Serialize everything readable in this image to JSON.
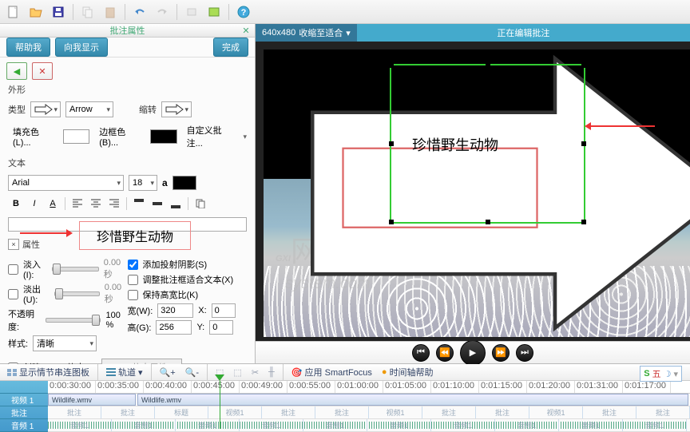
{
  "toolbar": {
    "new": "新建",
    "open": "打开",
    "save": "保存"
  },
  "panel": {
    "title": "批注属性",
    "help_me": "帮助我",
    "show_me": "向我显示",
    "finish": "完成"
  },
  "shape": {
    "section": "外形",
    "type_label": "类型",
    "type_value": "Arrow",
    "rotate_label": "缩转",
    "fill_label": "填充色(L)...",
    "border_label": "边框色(B)...",
    "custom_label": "自定义批注..."
  },
  "text": {
    "section": "文本",
    "font": "Arial",
    "size": "18",
    "content": "珍惜野生动物"
  },
  "props": {
    "section": "属性",
    "fadein_label": "淡入(I):",
    "fadein_value": "0.00 秒",
    "fadeout_label": "淡出(U):",
    "fadeout_value": "0.00 秒",
    "opacity_label": "不透明度:",
    "opacity_value": "100 %",
    "style_label": "样式:",
    "style_value": "清晰",
    "shadow_label": "添加投射阴影(S)",
    "fit_text_label": "调整批注框适合文本(X)",
    "keep_ratio_label": "保持高宽比(K)",
    "width_label": "宽(W):",
    "width_value": "320",
    "width_unit": "X:",
    "width_x": "0",
    "height_label": "高(G):",
    "height_value": "256",
    "height_unit": "Y:",
    "height_y": "0",
    "hotspot_label": "创建 Flash 热点(P)",
    "hotspot_btn": "Flash 热点属性..."
  },
  "preview": {
    "dims": "640x480",
    "zoom": "收缩至适合",
    "editing": "正在编辑批注",
    "callout_text": "珍惜野生动物",
    "wm_big": "GXI",
    "wm_suffix": "网",
    "wm_small": "system.com"
  },
  "timeline": {
    "thumbs_btn": "显示情节串连图板",
    "tracks_btn": "轨道",
    "smartfocus": "应用 SmartFocus",
    "help": "时间轴帮助",
    "ticks": [
      "0:00:30:00",
      "0:00:35:00",
      "0:00:40:00",
      "0:00:45:00",
      "0:00:49:00",
      "0:00:55:00",
      "0:01:00:00",
      "0:01:05:00",
      "0:01:10:00",
      "0:01:15:00",
      "0:01:20:00",
      "0:01:31:00",
      "0:01:17:00"
    ],
    "tracks": {
      "video": "视频 1",
      "anno": "批注",
      "audio": "音频 1"
    },
    "clip1": "Wildlife.wmv",
    "clip2": "Wildlife.wmv",
    "anno_labels": [
      "批注",
      "批注",
      "标题",
      "视频1",
      "批注",
      "批注",
      "视频1",
      "批注",
      "批注",
      "视频1",
      "批注",
      "批注"
    ],
    "audio_labels": [
      "音频1",
      "音频1",
      "音频1",
      "音频1",
      "音频1",
      "音频1",
      "音频1",
      "音频1",
      "音频1",
      "音频1"
    ]
  },
  "ime": {
    "text": "S 五"
  }
}
